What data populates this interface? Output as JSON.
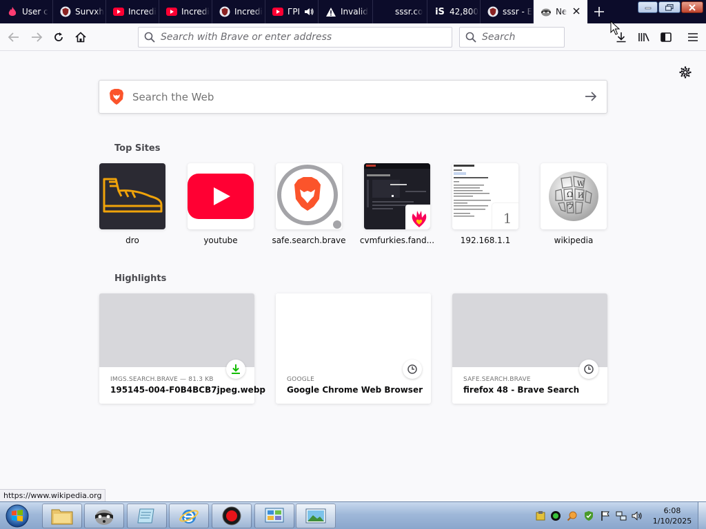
{
  "tabs": [
    {
      "title": "User c",
      "icon": "tinder-flame-icon"
    },
    {
      "title": "Survxh",
      "icon": "brave-shield-icon"
    },
    {
      "title": "Incredi",
      "icon": "youtube-icon"
    },
    {
      "title": "Incredi",
      "icon": "youtube-icon"
    },
    {
      "title": "Incredi",
      "icon": "brave-shield-icon"
    },
    {
      "title": "ГРІ",
      "icon": "youtube-icon"
    },
    {
      "title": "Invalid",
      "icon": "warning-icon"
    },
    {
      "title": "sssr.co",
      "icon": "blank-icon"
    },
    {
      "title": "42,800",
      "icon": "is-icon"
    },
    {
      "title": "sssr - E",
      "icon": "brave-shield-icon"
    },
    {
      "title": "Ne",
      "icon": "raccoon-icon"
    }
  ],
  "tab_badge": "iS",
  "navbar": {
    "url_placeholder": "Search with Brave or enter address",
    "search_placeholder": "Search"
  },
  "web_search": {
    "placeholder": "Search the Web"
  },
  "top_sites": {
    "heading": "Top Sites",
    "items": [
      {
        "label": "dro",
        "icon": "boot-icon"
      },
      {
        "label": "youtube",
        "icon": "youtube-logo-icon"
      },
      {
        "label": "safe.search.brave",
        "icon": "brave-lion-icon"
      },
      {
        "label": "cvmfurkies.fand...",
        "icon": "fandom-heart-icon"
      },
      {
        "label": "192.168.1.1",
        "icon": "page-thumbnail",
        "badge": "1"
      },
      {
        "label": "wikipedia",
        "icon": "wikipedia-globe-icon"
      }
    ]
  },
  "highlights": {
    "heading": "Highlights",
    "items": [
      {
        "source": "IMGS.SEARCH.BRAVE — 81.3 KB",
        "title": "195145-004-F0B4BCB7jpeg.webp",
        "icon": "download-icon"
      },
      {
        "source": "GOOGLE",
        "title": "Google Chrome Web Browser",
        "icon": "clock-icon"
      },
      {
        "source": "SAFE.SEARCH.BRAVE",
        "title": "firefox 48 - Brave Search",
        "icon": "clock-icon"
      }
    ]
  },
  "status_url": "https://www.wikipedia.org",
  "taskbar": {
    "time": "6:08",
    "date": "1/10/2025"
  },
  "colors": {
    "tabstrip": "#0c0c2a",
    "youtube_red": "#ff0033",
    "brave_orange": "#fb542b",
    "download_green": "#12bc00"
  }
}
